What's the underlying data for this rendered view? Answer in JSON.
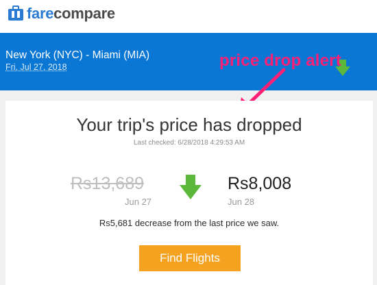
{
  "brand": {
    "part1": "fare",
    "part2": "compare",
    "icon": "suitcase-icon"
  },
  "trip": {
    "route": "New York (NYC) - Miami (MIA)",
    "date": "Fri, Jul 27, 2018"
  },
  "annotation": {
    "text": "price drop alert"
  },
  "alert": {
    "headline": "Your trip's price has dropped",
    "last_checked": "Last checked: 6/28/2018 4:29:53 AM",
    "old_price": "Rs13,689",
    "old_date": "Jun 27",
    "new_price": "Rs8,008",
    "new_date": "Jun 28",
    "decrease_text": "Rs5,681 decrease from the last price we saw.",
    "button_label": "Find Flights"
  },
  "colors": {
    "header_blue": "#0a77d4",
    "accent_green": "#5cb83b",
    "button_orange": "#f4a21f",
    "annotation_pink": "#ff1f74"
  }
}
